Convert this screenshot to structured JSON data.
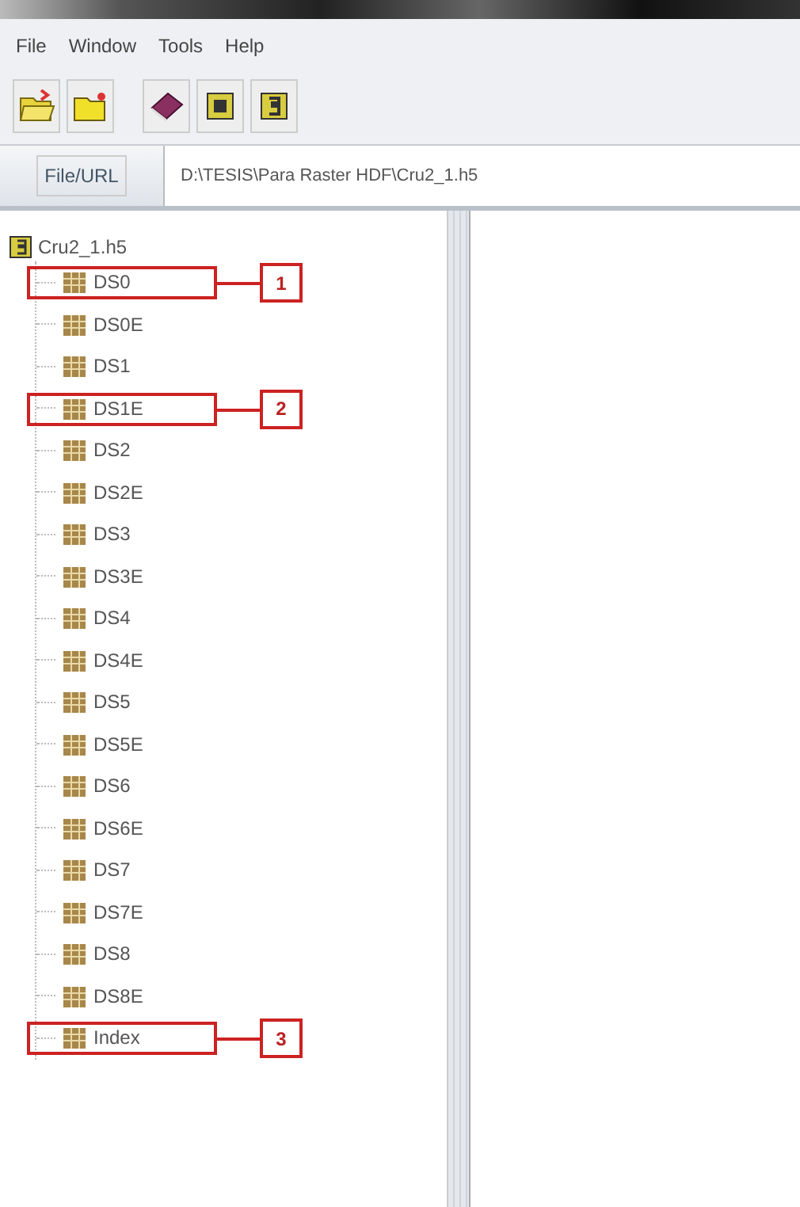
{
  "menu": [
    "File",
    "Window",
    "Tools",
    "Help"
  ],
  "file_url": {
    "label": "File/URL",
    "value": "D:\\TESIS\\Para Raster HDF\\Cru2_1.h5"
  },
  "tree": {
    "label": "Cru2_1.h5",
    "children": [
      {
        "label": "DS0",
        "callout": "1"
      },
      {
        "label": "DS0E"
      },
      {
        "label": "DS1"
      },
      {
        "label": "DS1E",
        "callout": "2"
      },
      {
        "label": "DS2"
      },
      {
        "label": "DS2E"
      },
      {
        "label": "DS3"
      },
      {
        "label": "DS3E"
      },
      {
        "label": "DS4"
      },
      {
        "label": "DS4E"
      },
      {
        "label": "DS5"
      },
      {
        "label": "DS5E"
      },
      {
        "label": "DS6"
      },
      {
        "label": "DS6E"
      },
      {
        "label": "DS7"
      },
      {
        "label": "DS7E"
      },
      {
        "label": "DS8"
      },
      {
        "label": "DS8E"
      },
      {
        "label": "Index",
        "callout": "3"
      }
    ]
  }
}
